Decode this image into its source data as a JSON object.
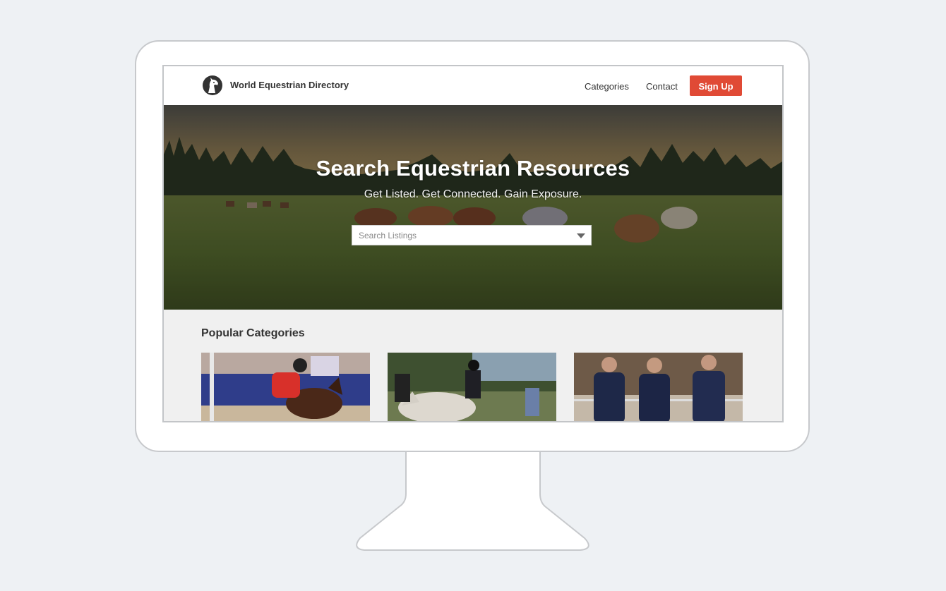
{
  "nav": {
    "brand": "World Equestrian Directory",
    "links": [
      "Categories",
      "Contact"
    ],
    "signup_label": "Sign Up"
  },
  "hero": {
    "title": "Search Equestrian Resources",
    "subtitle": "Get Listed. Get Connected. Gain Exposure.",
    "search_placeholder": "Search Listings"
  },
  "categories": {
    "title": "Popular Categories",
    "cards": [
      {
        "image": "show-jumping-photo"
      },
      {
        "image": "dressage-photo"
      },
      {
        "image": "riders-photo"
      }
    ]
  },
  "colors": {
    "accent": "#e04a35",
    "page_bg": "#eef1f4",
    "section_bg": "#f0f0f0"
  }
}
